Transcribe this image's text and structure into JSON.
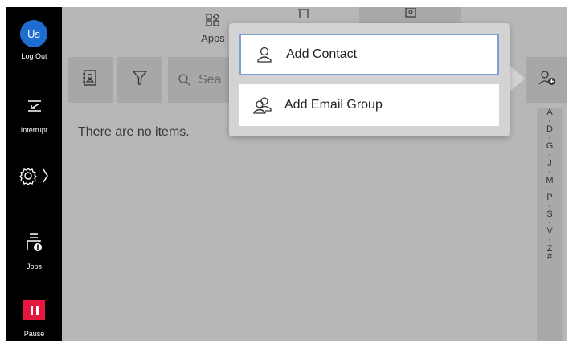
{
  "sidebar": {
    "avatar_initials": "Us",
    "logout_label": "Log Out",
    "interrupt_label": "Interrupt",
    "jobs_label": "Jobs",
    "pause_label": "Pause",
    "pause_color": "#e5173f",
    "avatar_color": "#1e6ed1"
  },
  "tabs": [
    {
      "label": "Apps",
      "icon": "apps-grid-icon"
    },
    {
      "label": "",
      "icon": "device-icon"
    },
    {
      "label": "",
      "icon": "address-book-icon",
      "active": true
    }
  ],
  "toolbar": {
    "search_placeholder": "Sea"
  },
  "content": {
    "empty_message": "There are no items."
  },
  "alpha_index": [
    "A",
    "·",
    "D",
    "·",
    "G",
    "·",
    "J",
    "·",
    "M",
    "·",
    "P",
    "·",
    "S",
    "·",
    "V",
    "·",
    "Z",
    "#"
  ],
  "popup_menu": {
    "items": [
      {
        "label": "Add Contact",
        "icon": "person-icon",
        "selected": true
      },
      {
        "label": "Add Email Group",
        "icon": "people-group-icon",
        "selected": false
      }
    ]
  }
}
